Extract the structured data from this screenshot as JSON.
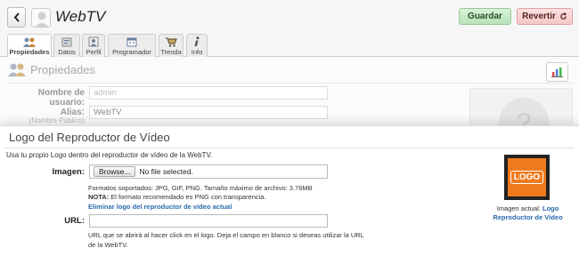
{
  "header": {
    "title": "WebTV",
    "save_label": "Guardar",
    "revert_label": "Revertir"
  },
  "tabs": [
    {
      "label": "Propiedades",
      "icon": "users-icon",
      "active": true
    },
    {
      "label": "Datos",
      "icon": "data-icon"
    },
    {
      "label": "Perfil",
      "icon": "profile-icon"
    },
    {
      "label": "Programador",
      "icon": "calendar-icon"
    },
    {
      "label": "Trenda",
      "icon": "cart-icon"
    },
    {
      "label": "Info",
      "icon": "info-icon"
    }
  ],
  "properties": {
    "heading": "Propiedades",
    "username_label": "Nombre de usuario:",
    "username_value": "admin",
    "alias_label": "Alias:",
    "alias_sublabel": "(Nombre Público)",
    "alias_value": "WebTV"
  },
  "modal": {
    "title": "Logo del Reproductor de Vídeo",
    "description": "Usa tu propio Logo dentro del reproductor de vídeo de la WebTV.",
    "image_label": "Imagen:",
    "browse_label": "Browse...",
    "file_status": "No file selected.",
    "formats_text": "Formatos soportados: JPG, GIF, PNG. Tamaño máximo de archivo: 3.76MB",
    "note_label": "NOTA:",
    "note_text": " El formato recomendado es PNG con transparencia.",
    "delete_link": "Eliminar logo del reproductor de vídeo actual",
    "url_label": "URL:",
    "url_value": "",
    "url_help": "URL que se abrirá al hacer click en el logo. Deja el campo en blanco si deseas utilizar la URL de la WebTV.",
    "logo_text": "LOGO",
    "current_image_label": "Imagen actual:",
    "current_image_link": "Logo Reproductor de Vídeo"
  },
  "colors": {
    "save_bg": "#c8ebc8",
    "revert_bg": "#f8d4d4",
    "link": "#2a6ab0",
    "logo_orange": "#f07a1e"
  }
}
